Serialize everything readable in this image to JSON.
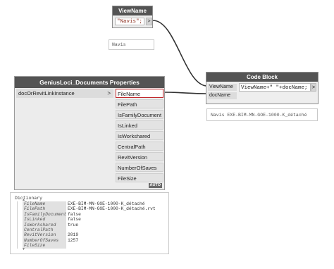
{
  "wire_color": "#333333",
  "selection_color": "#c0282c",
  "viewname_node": {
    "title": "ViewName",
    "value": "\"Navis\";",
    "out_port": ">"
  },
  "viewname_preview": "Navis",
  "properties_node": {
    "title": "GeniusLoci_Documents Properties",
    "input": "docOrRevitLinkInstance",
    "input_arrow": ">",
    "outputs": [
      "FileName",
      "FilePath",
      "IsFamilyDocument",
      "IsLinked",
      "IsWorkshared",
      "CentralPath",
      "RevitVersion",
      "NumberOfSaves",
      "FileSize"
    ],
    "selected_output": "FileName",
    "lacing": "AUTO"
  },
  "code_block_node": {
    "title": "Code Block",
    "inputs": [
      "ViewName",
      "docName"
    ],
    "code": "ViewName+\" \"+docName;",
    "out_port": ">"
  },
  "code_block_preview": "Navis EXE-BIM-MN-GOE-1000-K_détaché",
  "dictionary_preview": {
    "title": "Dictionary",
    "entries": [
      {
        "key": "FileName",
        "value": "EXE-BIM-MN-GOE-1000-K_détaché"
      },
      {
        "key": "FilePath",
        "value": "EXE-BIM-MN-GOE-1000-K_détaché.rvt"
      },
      {
        "key": "IsFamilyDocument",
        "value": "false"
      },
      {
        "key": "IsLinked",
        "value": "false"
      },
      {
        "key": "IsWorkshared",
        "value": "true"
      },
      {
        "key": "CentralPath",
        "value": ""
      },
      {
        "key": "RevitVersion",
        "value": "2019"
      },
      {
        "key": "NumberOfSaves",
        "value": "1257"
      },
      {
        "key": "FileSize",
        "value": ""
      }
    ]
  }
}
